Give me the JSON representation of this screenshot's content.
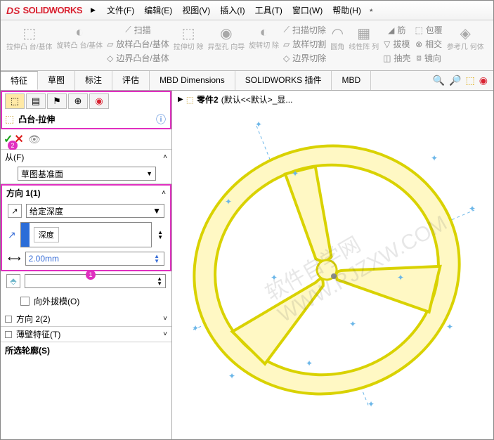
{
  "app": {
    "logo_ds": "DS",
    "logo_sw": "SOLIDWORKS"
  },
  "menus": [
    "文件(F)",
    "编辑(E)",
    "视图(V)",
    "插入(I)",
    "工具(T)",
    "窗口(W)",
    "帮助(H)"
  ],
  "ribbon": {
    "b1": "拉伸凸\n台/基体",
    "b2": "旋转凸\n台/基体",
    "b3": "扫描",
    "b4": "放样凸台/基体",
    "b5": "边界凸台/基体",
    "b6": "拉伸切\n除",
    "b7": "异型孔\n向导",
    "b8": "旋转切\n除",
    "b9": "扫描切除",
    "b10": "放样切割",
    "b11": "边界切除",
    "b12": "圆角",
    "b13": "线性阵\n列",
    "b14": "筋",
    "b15": "拔模",
    "b16": "抽壳",
    "b17": "包覆",
    "b18": "相交",
    "b19": "镜向",
    "b20": "参考几\n何体"
  },
  "tabs": [
    "特征",
    "草图",
    "标注",
    "评估",
    "MBD Dimensions",
    "SOLIDWORKS 插件",
    "MBD"
  ],
  "feature": {
    "title": "凸台-拉伸",
    "from_label": "从(F)",
    "from_value": "草图基准面",
    "dir1_label": "方向 1(1)",
    "dir1_end": "给定深度",
    "depth_lbl": "深度",
    "depth_val": "2.00mm",
    "draft_label": "向外拔模(O)",
    "dir2_label": "方向 2(2)",
    "thin_label": "薄壁特征(T)",
    "contours_label": "所选轮廓(S)"
  },
  "breadcrumb": {
    "part": "零件2",
    "state": "(默认<<默认>_显..."
  },
  "badges": {
    "b1": "1",
    "b2": "2"
  },
  "watermark": "软件自学网\nWWW.RJZXW.COM"
}
